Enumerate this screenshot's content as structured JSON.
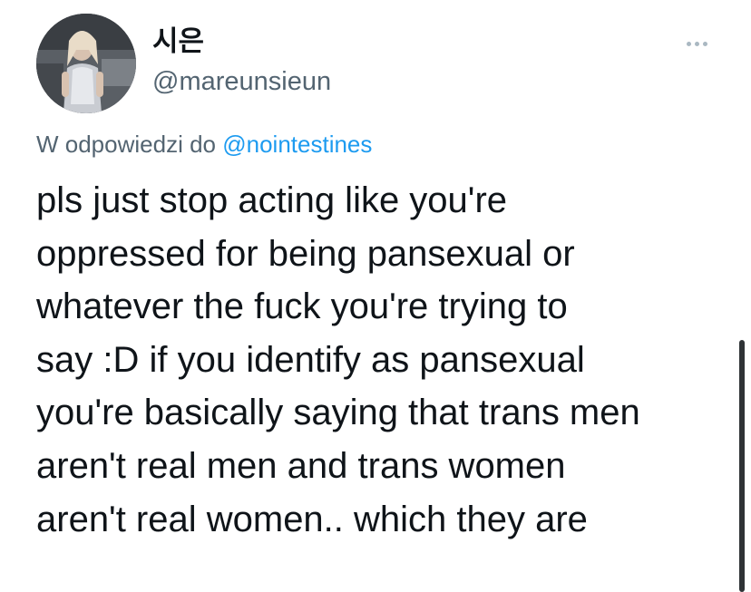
{
  "user": {
    "display_name": "시은",
    "handle": "@mareunsieun",
    "avatar_icon": "user-avatar-photo"
  },
  "reply": {
    "prefix": "W odpowiedzi do",
    "mention": "@nointestines"
  },
  "tweet": {
    "lines": [
      "pls just stop acting like you're",
      "oppressed for being pansexual or",
      "whatever the fuck you're trying to",
      "say :D if you identify as pansexual",
      "you're basically saying that trans men",
      "aren't real men and trans women",
      "aren't real women.. which they are"
    ]
  },
  "icons": {
    "more": "more-options-icon"
  },
  "colors": {
    "text": "#0f1419",
    "secondary": "#536471",
    "link": "#1d9bf0",
    "background": "#ffffff"
  }
}
